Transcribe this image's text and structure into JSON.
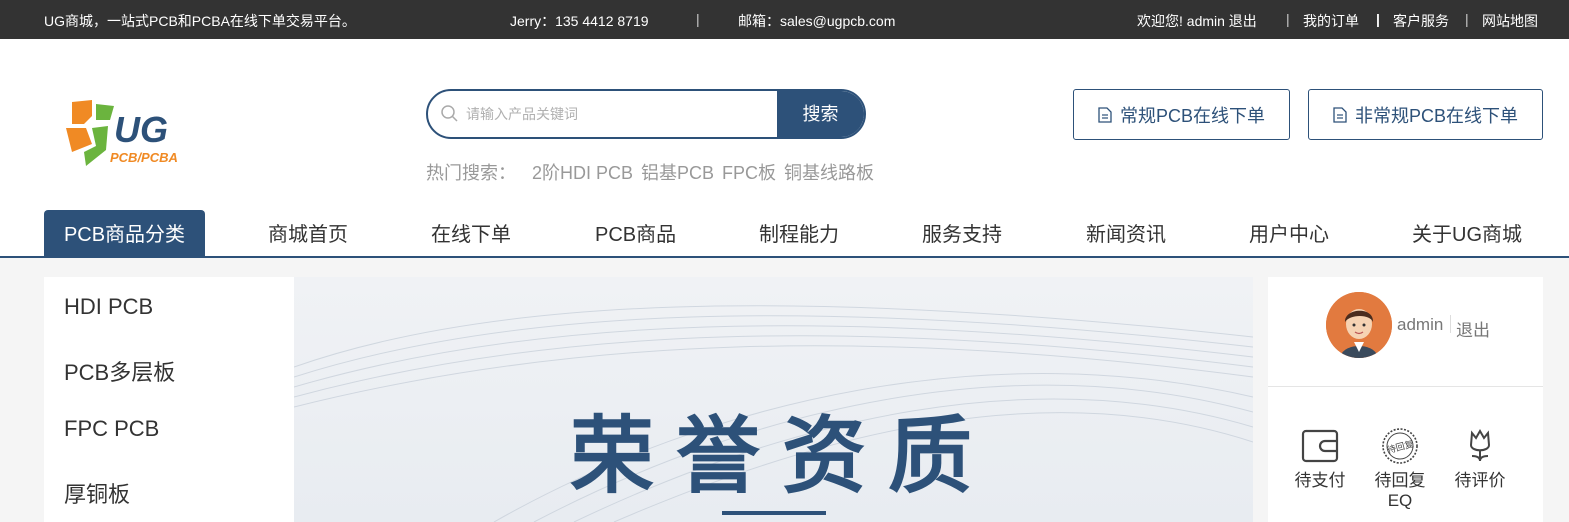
{
  "topbar": {
    "slogan": "UG商城，一站式PCB和PCBA在线下单交易平台。",
    "contact": "Jerry：135 4412 8719",
    "divider": "|",
    "email": "邮箱：sales@ugpcb.com",
    "welcome": "欢迎您!  admin 退出",
    "sep": "|",
    "my_orders": "我的订单",
    "customer_service": "客户服务",
    "sitemap": "网站地图"
  },
  "logo": {
    "main": "UG",
    "sub": "PCB/PCBA"
  },
  "search": {
    "placeholder": "请输入产品关键词",
    "button": "搜索",
    "hot_label": "热门搜索：",
    "hot_terms": [
      "2阶HDI PCB",
      "铝基PCB",
      "FPC板",
      "铜基线路板"
    ]
  },
  "order_buttons": {
    "regular": "常规PCB在线下单",
    "irregular": "非常规PCB在线下单"
  },
  "nav": {
    "items": [
      "PCB商品分类",
      "商城首页",
      "在线下单",
      "PCB商品",
      "制程能力",
      "服务支持",
      "新闻资讯",
      "用户中心",
      "关于UG商城"
    ]
  },
  "categories": [
    "HDI PCB",
    "PCB多层板",
    "FPC PCB",
    "厚铜板"
  ],
  "banner": {
    "title": "荣誉资质"
  },
  "user": {
    "name": "admin",
    "logout": "退出",
    "stats": [
      "待支付",
      "待回复\nEQ",
      "待评价"
    ],
    "stamp_text": "待回复"
  },
  "colors": {
    "brand": "#2d5179",
    "topbar": "#333333",
    "logo_orange": "#f08a24",
    "logo_green": "#6bb43e"
  }
}
